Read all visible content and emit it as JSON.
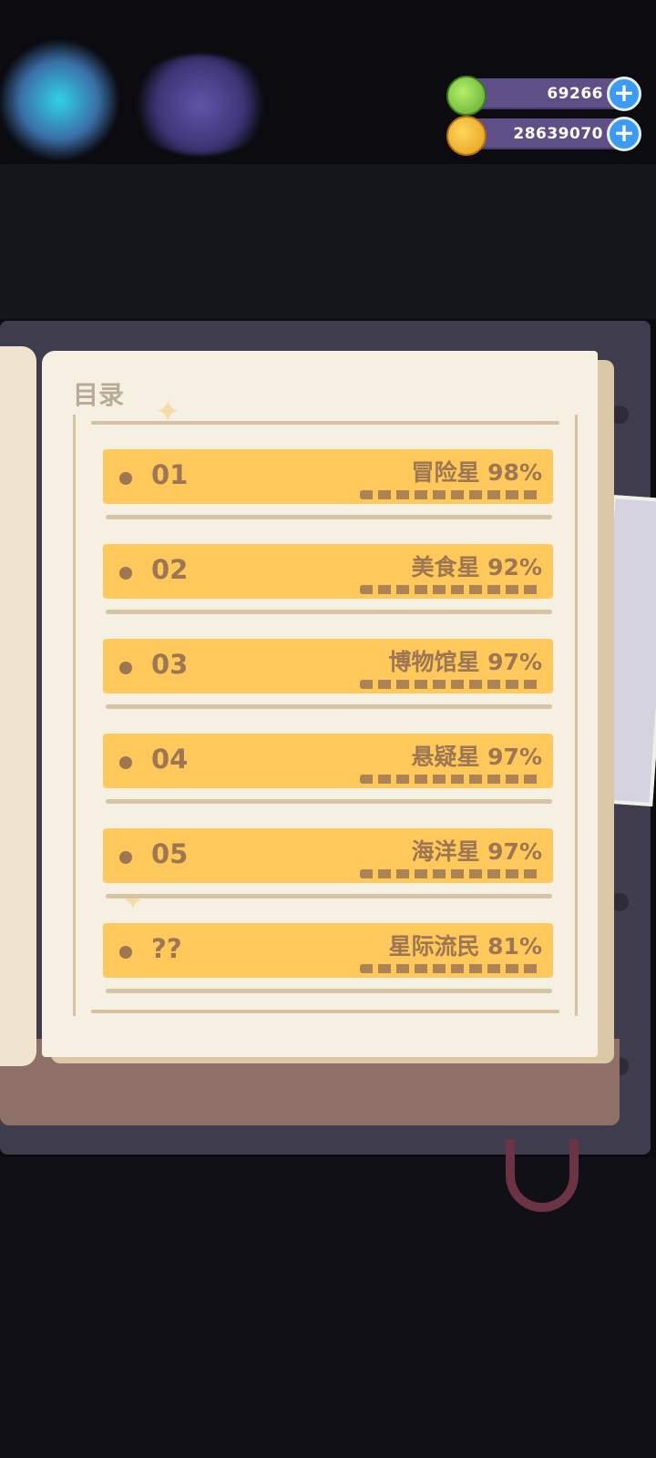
{
  "currencies": [
    {
      "icon": "gem-icon",
      "amount": "69266",
      "color": "#7bd14a"
    },
    {
      "icon": "planet-coin-icon",
      "amount": "28639070",
      "color": "#f6b72d"
    }
  ],
  "toc": {
    "title": "目录",
    "entries": [
      {
        "num": "01",
        "label": "冒险星 98%"
      },
      {
        "num": "02",
        "label": "美食星 92%"
      },
      {
        "num": "03",
        "label": "博物馆星 97%"
      },
      {
        "num": "04",
        "label": "悬疑星 97%"
      },
      {
        "num": "05",
        "label": "海洋星 97%"
      },
      {
        "num": "??",
        "label": "星际流民 81%"
      }
    ]
  },
  "colors": {
    "entry_bg": "#ffc85a",
    "entry_text": "#9d7753",
    "page": "#f6f0e2",
    "accent_blue": "#3b9bf2"
  }
}
